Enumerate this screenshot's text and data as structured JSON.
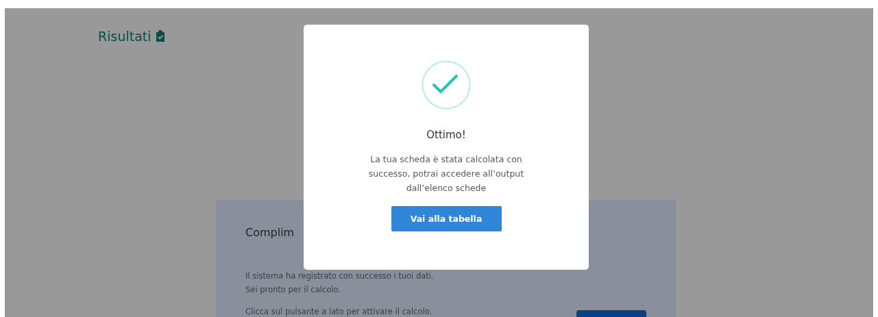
{
  "page": {
    "title": "Risultati"
  },
  "card": {
    "heading": "Complim",
    "lines": [
      "Il sistema ha registrato con successo i tuoi dati.",
      "Sei pronto per il calcolo."
    ],
    "note": "Clicca sul pulsante a lato per attivare il calcolo."
  },
  "modal": {
    "title": "Ottimo!",
    "message": "La tua scheda è stata calcolata con successo, potrai accedere all’output dall’elenco schede",
    "button": "Vai alla tabella"
  }
}
